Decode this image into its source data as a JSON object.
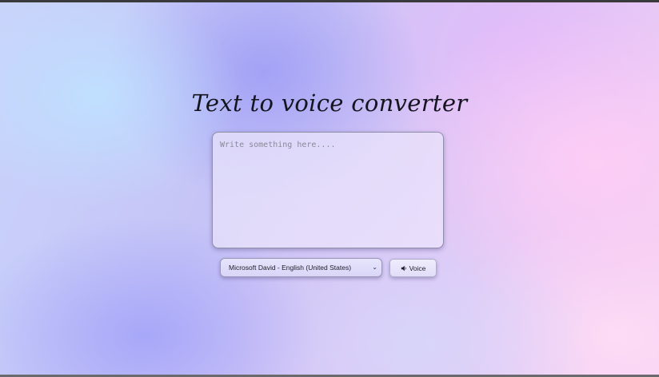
{
  "app": {
    "title": "Text to voice converter"
  },
  "editor": {
    "placeholder": "Write something here....",
    "value": ""
  },
  "voice_select": {
    "selected": "Microsoft David - English (United States)",
    "chevron_icon": "chevron-down-icon"
  },
  "voice_button": {
    "label": "Voice",
    "icon": "speaker-icon"
  },
  "colors": {
    "title_text": "#15151f",
    "panel_bg": "#e2defa",
    "border": "#8f8fa8"
  }
}
